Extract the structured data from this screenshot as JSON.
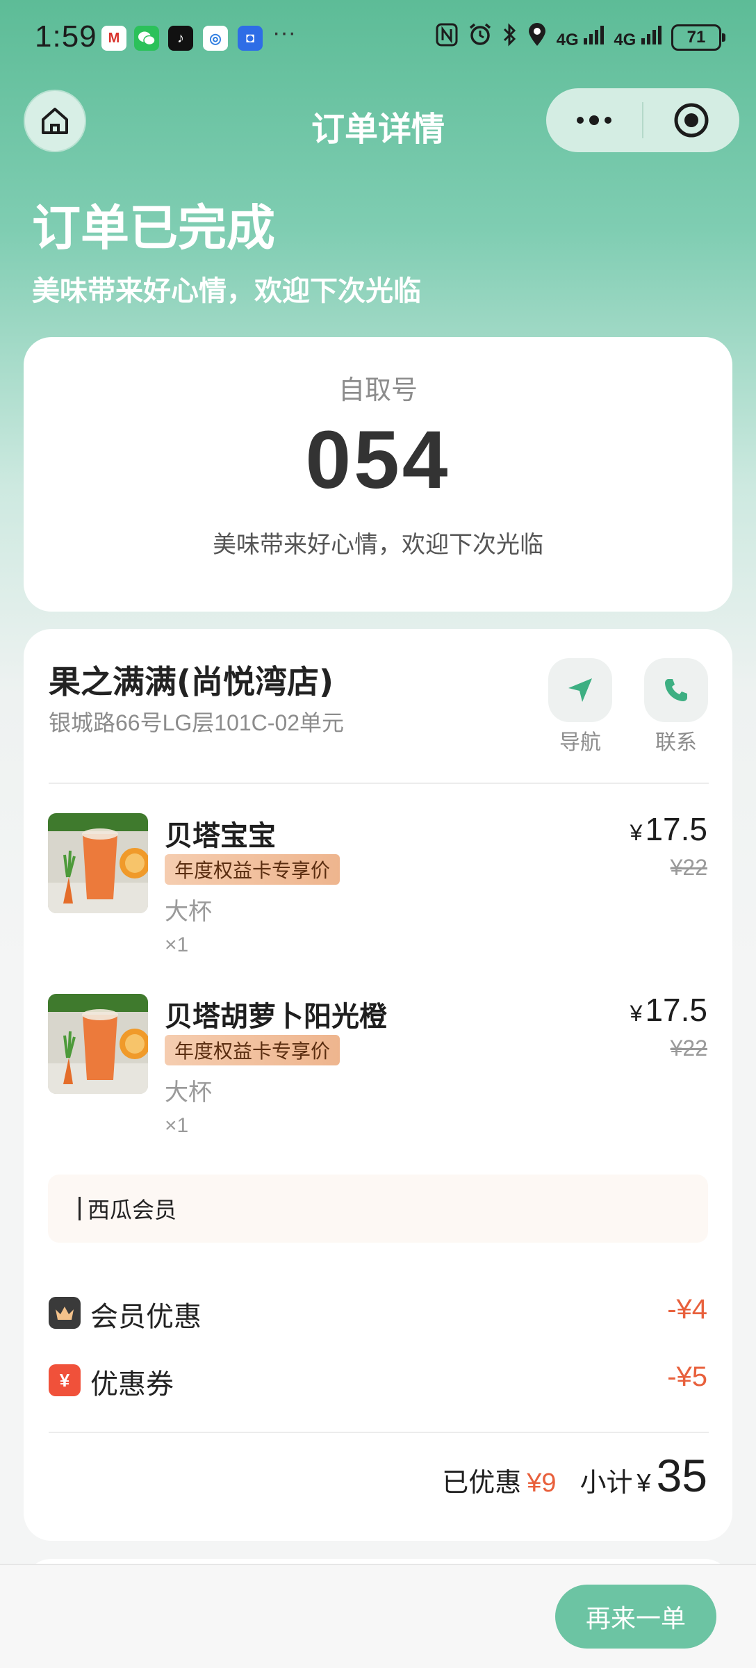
{
  "status_bar": {
    "time": "1:59",
    "more": "···",
    "network_1": "4G",
    "network_2": "4G",
    "battery": "71"
  },
  "nav": {
    "title": "订单详情"
  },
  "header": {
    "status": "订单已完成",
    "subtitle": "美味带来好心情，欢迎下次光临"
  },
  "pickup": {
    "label": "自取号",
    "number": "054",
    "message": "美味带来好心情，欢迎下次光临"
  },
  "store": {
    "name": "果之满满(尚悦湾店)",
    "address": "银城路66号LG层101C-02单元",
    "navigate_label": "导航",
    "contact_label": "联系"
  },
  "products": [
    {
      "name": "贝塔宝宝",
      "tag": "年度权益卡专享价",
      "spec": "大杯",
      "qty": "×1",
      "currency": "¥",
      "price": "17.5",
      "original_price": "¥22"
    },
    {
      "name": "贝塔胡萝卜阳光橙",
      "tag": "年度权益卡专享价",
      "spec": "大杯",
      "qty": "×1",
      "currency": "¥",
      "price": "17.5",
      "original_price": "¥22"
    }
  ],
  "member": {
    "label": "西瓜会员"
  },
  "discounts": [
    {
      "label": "会员优惠",
      "value": "-¥4",
      "icon": "crown-icon",
      "color": "#3a3a3a"
    },
    {
      "label": "优惠券",
      "value": "-¥5",
      "icon": "coupon-yen-icon",
      "color": "#f0513a"
    }
  ],
  "summary": {
    "discount_label": "已优惠",
    "discount_value": "¥9",
    "subtotal_label": "小计",
    "currency": "¥",
    "subtotal_value": "35"
  },
  "footer": {
    "reorder_label": "再来一单"
  },
  "colors": {
    "primary_green": "#5dbc97",
    "button_green": "#6cc4a3",
    "discount_red": "#e8603c"
  }
}
